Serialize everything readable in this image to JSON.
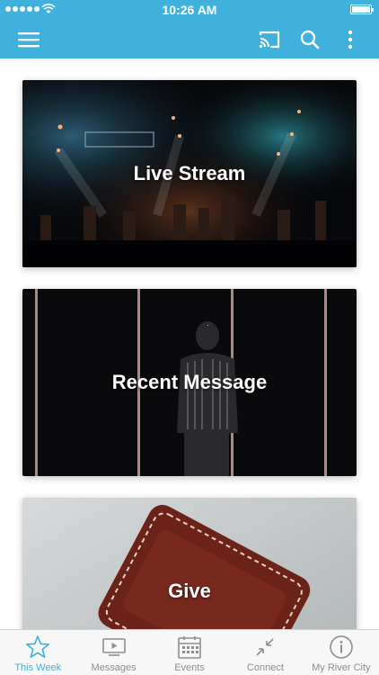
{
  "status_bar": {
    "time": "10:26 AM"
  },
  "nav": {
    "menu_icon": "hamburger-icon",
    "cast_icon": "cast-icon",
    "search_icon": "search-icon",
    "more_icon": "more-vertical-icon"
  },
  "cards": [
    {
      "label": "Live Stream"
    },
    {
      "label": "Recent Message"
    },
    {
      "label": "Give"
    }
  ],
  "tabs": [
    {
      "label": "This Week",
      "icon": "star-icon",
      "active": true
    },
    {
      "label": "Messages",
      "icon": "video-icon",
      "active": false
    },
    {
      "label": "Events",
      "icon": "calendar-icon",
      "active": false
    },
    {
      "label": "Connect",
      "icon": "connect-icon",
      "active": false
    },
    {
      "label": "My River City",
      "icon": "info-icon",
      "active": false
    }
  ],
  "colors": {
    "brand": "#3fb1dc",
    "tab_inactive": "#8e8e93",
    "tab_active": "#3fb1dc"
  }
}
